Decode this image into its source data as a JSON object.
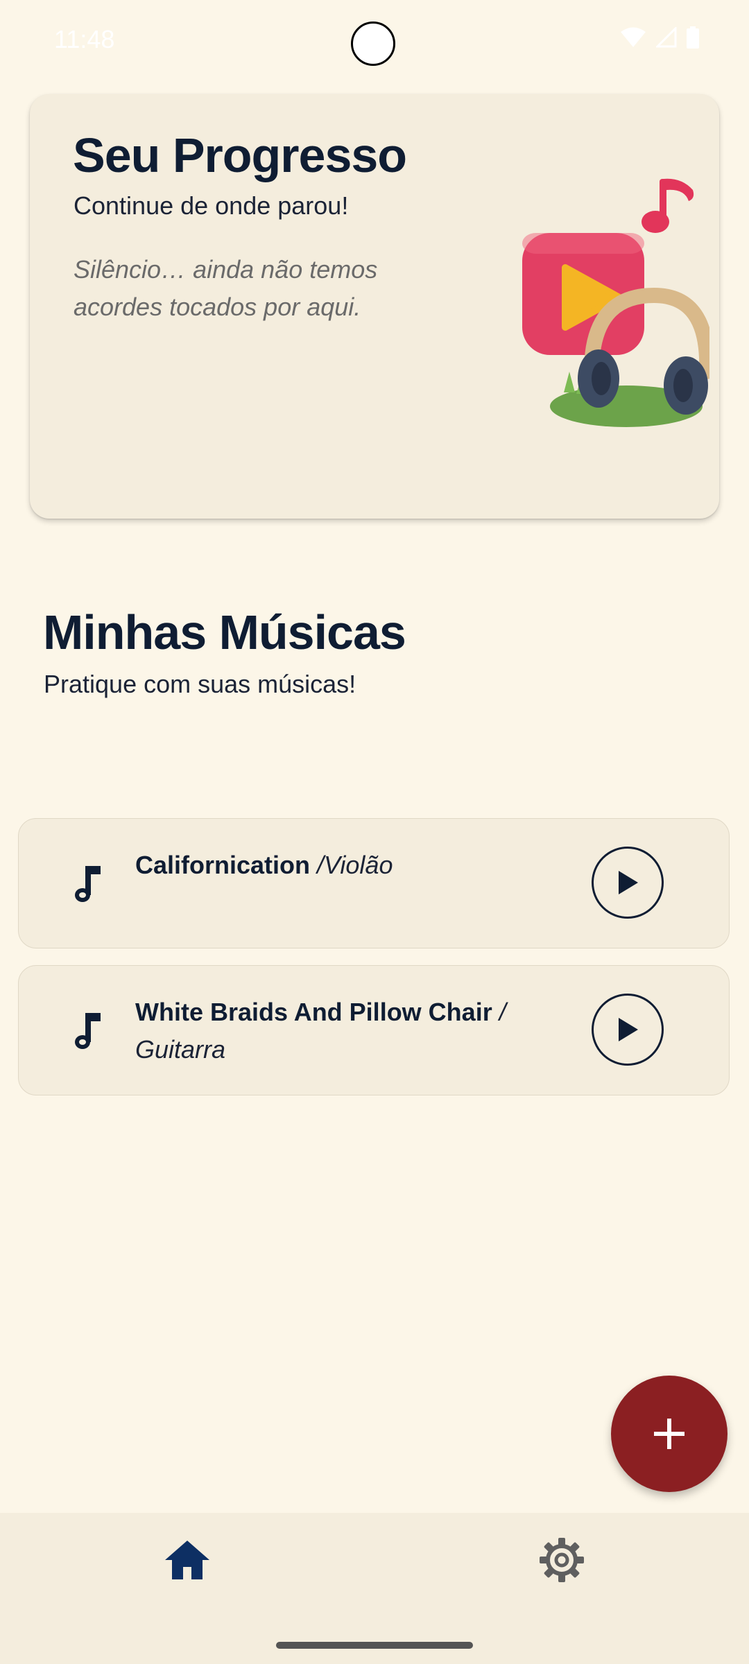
{
  "status_bar": {
    "time": "11:48",
    "icons": [
      "wifi-icon",
      "signal-icon",
      "battery-icon"
    ]
  },
  "progress_card": {
    "title": "Seu Progresso",
    "subtitle": "Continue de onde parou!",
    "empty_message": "Silêncio… ainda não temos acordes tocados por aqui.",
    "illustration": "music-headphones-illustration"
  },
  "songs_section": {
    "title": "Minhas Músicas",
    "subtitle": "Pratique com suas músicas!",
    "items": [
      {
        "title": "Californication",
        "separator": " /",
        "instrument": "Violão"
      },
      {
        "title": "White Braids And Pillow Chair",
        "separator": " /",
        "instrument": "Guitarra"
      }
    ]
  },
  "fab": {
    "icon": "plus-icon"
  },
  "bottom_nav": {
    "items": [
      {
        "icon": "home-icon",
        "selected": true
      },
      {
        "icon": "gear-icon",
        "selected": false
      }
    ]
  },
  "colors": {
    "background": "#fcf6e8",
    "card": "#f4eddd",
    "text": "#0f1d33",
    "fab": "#8b1f22",
    "nav_selected": "#0d2f63",
    "nav_unselected": "#5f5f5f"
  }
}
